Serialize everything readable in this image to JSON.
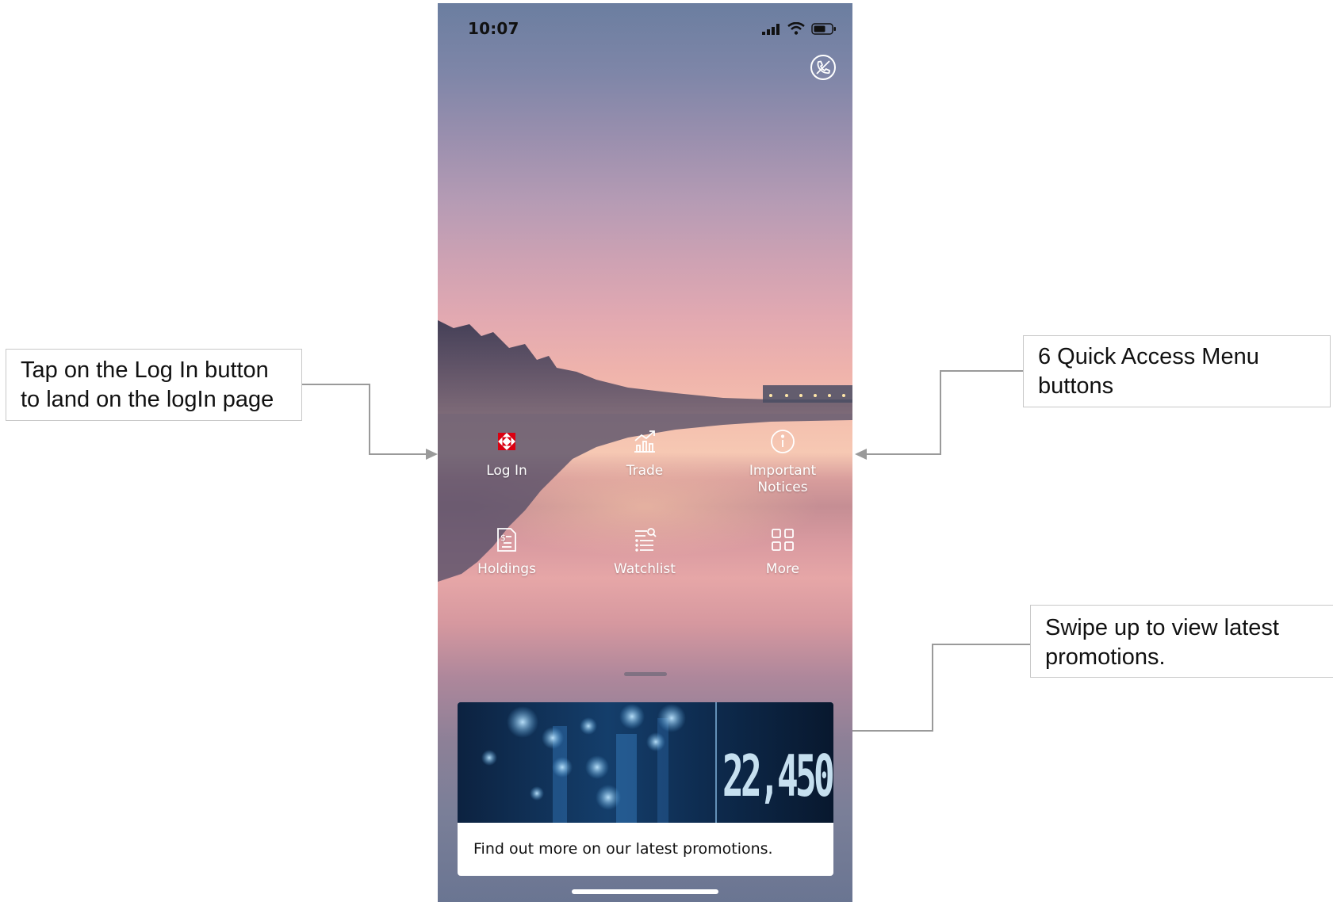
{
  "annotations": {
    "login": "Tap on the Log In button\nto land on the logIn page",
    "quick_access": "6 Quick Access Menu\nbuttons",
    "swipe": "Swipe up to view latest\npromotions."
  },
  "status_bar": {
    "time": "10:07",
    "icons": [
      "signal-icon",
      "wifi-icon",
      "battery-icon"
    ]
  },
  "header": {
    "call_icon": "phone-call-icon"
  },
  "quick_access_menu": [
    {
      "label": "Log In",
      "icon": "logo-icon"
    },
    {
      "label": "Trade",
      "icon": "trade-chart-icon"
    },
    {
      "label": "Important\nNotices",
      "icon": "info-icon"
    },
    {
      "label": "Holdings",
      "icon": "holdings-document-icon"
    },
    {
      "label": "Watchlist",
      "icon": "watchlist-icon"
    },
    {
      "label": "More",
      "icon": "grid-icon"
    }
  ],
  "promotion": {
    "image_ticker": "22,450",
    "text": "Find out more on our latest promotions."
  },
  "colors": {
    "brand_red": "#db0011",
    "annotation_border": "#c8c8c8",
    "connector": "#9a9a9a"
  }
}
